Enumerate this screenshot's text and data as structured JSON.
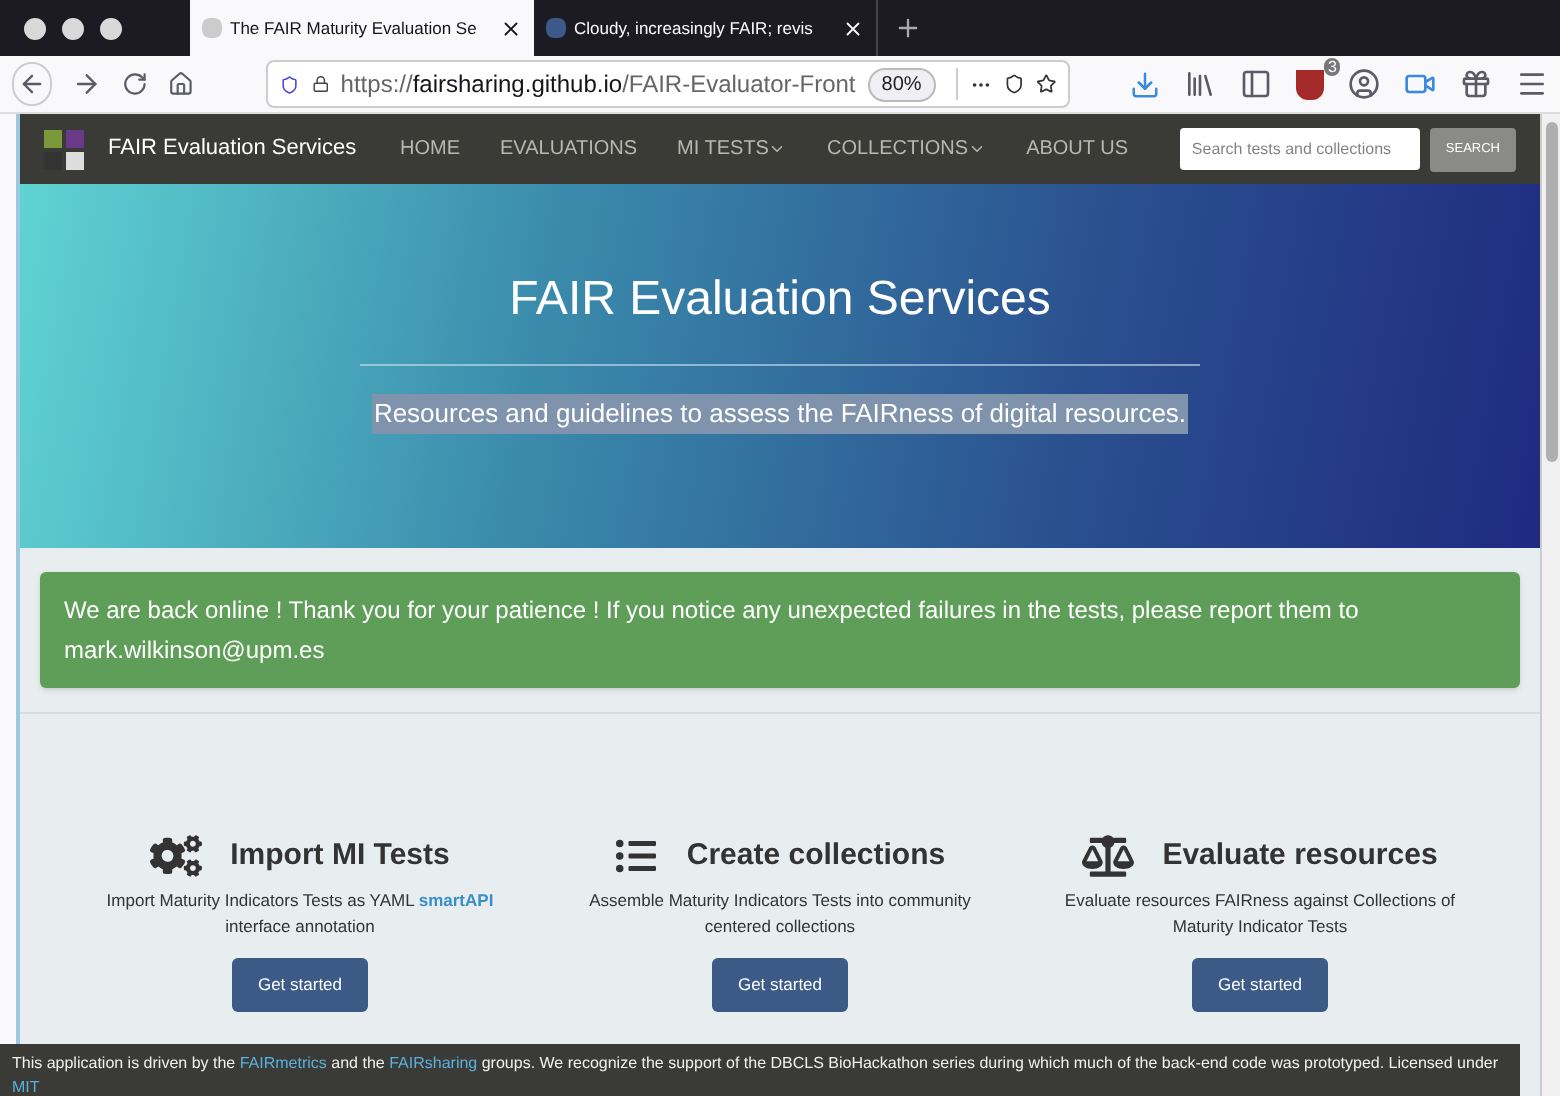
{
  "browser": {
    "tabs": [
      {
        "title": "The FAIR Maturity Evaluation Se",
        "selected": true
      },
      {
        "title": "Cloudy, increasingly FAIR; revis",
        "selected": false
      }
    ],
    "url": {
      "scheme": "https://",
      "host": "fairsharing.github.io",
      "path": "/FAIR-Evaluator-Front"
    },
    "zoom": "80%",
    "extension_badge": "3"
  },
  "navbar": {
    "brand": "FAIR Evaluation Services",
    "items": [
      {
        "label": "HOME",
        "dropdown": false
      },
      {
        "label": "EVALUATIONS",
        "dropdown": false
      },
      {
        "label": "MI TESTS",
        "dropdown": true
      },
      {
        "label": "COLLECTIONS",
        "dropdown": true
      },
      {
        "label": "ABOUT US",
        "dropdown": false
      }
    ],
    "search": {
      "placeholder": "Search tests and collections"
    },
    "search_button": "SEARCH"
  },
  "hero": {
    "title": "FAIR Evaluation Services",
    "subtitle": "Resources and guidelines to assess the FAIRness of digital resources."
  },
  "alert": {
    "text": "We are back online ! Thank you for your patience ! If you notice any unexpected failures in the tests, please report them to mark.wilkinson@upm.es"
  },
  "features": [
    {
      "kind": "gears",
      "title": "Import MI Tests",
      "description": "Import Maturity Indicators Tests as YAML",
      "link": "smartAPI",
      "description_after": "interface annotation",
      "button": "Get started"
    },
    {
      "kind": "list",
      "title": "Create collections",
      "description": "Assemble Maturity Indicators Tests into community centered collections",
      "button": "Get started"
    },
    {
      "kind": "scale",
      "title": "Evaluate resources",
      "description": "Evaluate resources FAIRness against Collections of Maturity Indicator Tests",
      "button": "Get started"
    }
  ],
  "footer": [
    {
      "kind": "text",
      "text": "This application is driven by the"
    },
    {
      "kind": "link",
      "text": "FAIRmetrics"
    },
    {
      "kind": "text",
      "text": "and the"
    },
    {
      "kind": "link",
      "text": "FAIRsharing"
    },
    {
      "kind": "text",
      "text": "groups. We recognize the support of the DBCLS BioHackathon series during which much of the back-end code was prototyped. Licensed under"
    },
    {
      "kind": "link",
      "text": "MIT"
    }
  ]
}
